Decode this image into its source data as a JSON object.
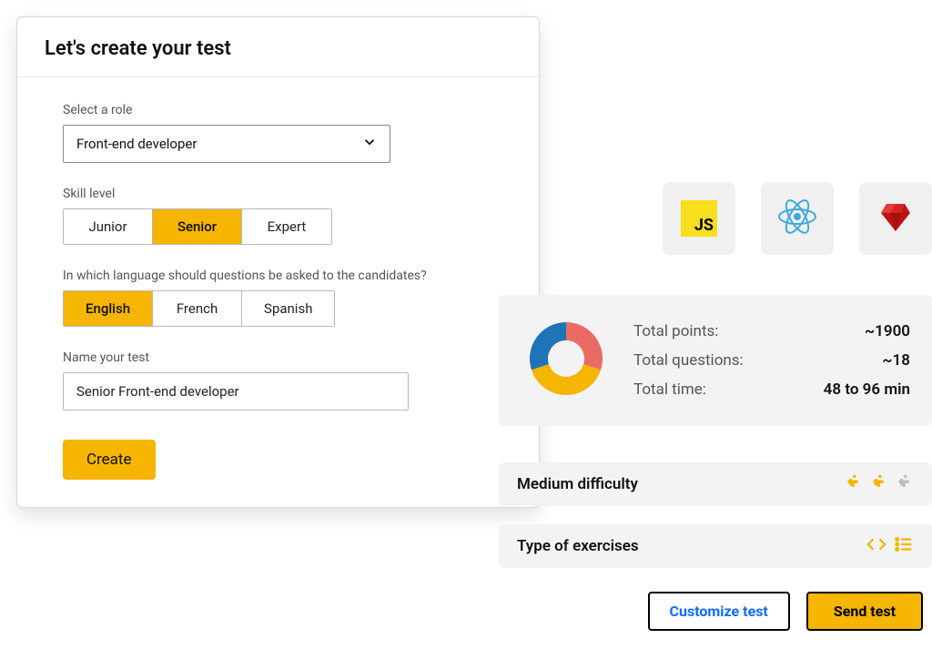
{
  "form": {
    "title": "Let's create your test",
    "role": {
      "label": "Select a role",
      "value": "Front-end developer"
    },
    "skill": {
      "label": "Skill level",
      "options": [
        "Junior",
        "Senior",
        "Expert"
      ],
      "selected": "Senior"
    },
    "language": {
      "label": "In which language should questions be asked to the candidates?",
      "options": [
        "English",
        "French",
        "Spanish"
      ],
      "selected": "English"
    },
    "name": {
      "label": "Name your test",
      "value": "Senior Front-end developer"
    },
    "create": "Create"
  },
  "tech": [
    {
      "id": "js",
      "label": "JS"
    },
    {
      "id": "react",
      "label": ""
    },
    {
      "id": "ruby",
      "label": ""
    }
  ],
  "summary": {
    "rows": [
      {
        "label": "Total points:",
        "value": "~1900"
      },
      {
        "label": "Total questions:",
        "value": "~18"
      },
      {
        "label": "Total time:",
        "value": "48 to 96 min"
      }
    ]
  },
  "chart_data": {
    "type": "pie",
    "title": "",
    "categories": [
      "blue",
      "red",
      "yellow"
    ],
    "values": [
      30,
      35,
      35
    ],
    "colors": [
      "#1f73b7",
      "#ea6a64",
      "#f5b500"
    ]
  },
  "difficulty": {
    "label": "Medium difficulty"
  },
  "exercises": {
    "label": "Type of exercises"
  },
  "actions": {
    "customize": "Customize test",
    "send": "Send test"
  }
}
